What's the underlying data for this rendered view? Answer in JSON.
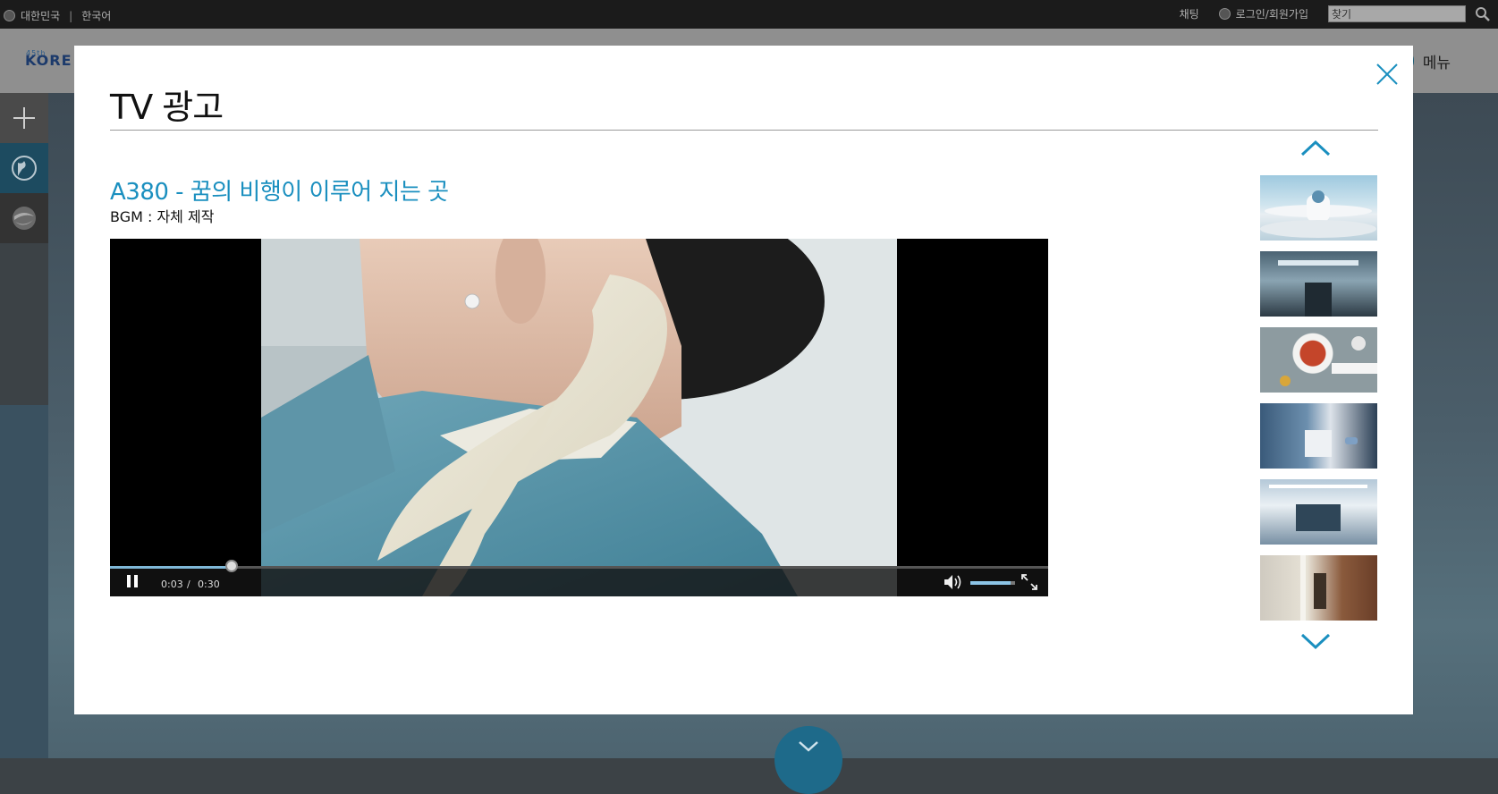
{
  "topbar": {
    "region": "대한민국",
    "divider": "|",
    "language": "한국어",
    "chat": "채팅",
    "login": "로그인/회원가입",
    "search_placeholder": "찾기"
  },
  "header": {
    "logo_prefix": "45th",
    "logo_text": "KORE",
    "menu_label": "메뉴"
  },
  "sidebar": {
    "items": [
      {
        "icon": "plus-icon"
      },
      {
        "icon": "globe-icon"
      },
      {
        "icon": "korean-air-logo-icon"
      }
    ]
  },
  "modal": {
    "title": "TV 광고",
    "video_title": "A380 - 꿈의 비행이 이루어 지는 곳",
    "bgm": "BGM : 자체 제작",
    "player": {
      "current_time": "0:03",
      "separator": "/",
      "duration": "0:30",
      "progress": 0.13,
      "volume": 0.9
    },
    "thumbnails": [
      {
        "name": "thumb-a380-exterior"
      },
      {
        "name": "thumb-cabin-stairs"
      },
      {
        "name": "thumb-meal-tray"
      },
      {
        "name": "thumb-lounge-seats"
      },
      {
        "name": "thumb-bar-lounge"
      },
      {
        "name": "thumb-corridor"
      }
    ]
  },
  "colors": {
    "accent": "#1a8fbf",
    "modal_bg": "#ffffff",
    "topbar_bg": "#1b1b1b"
  }
}
